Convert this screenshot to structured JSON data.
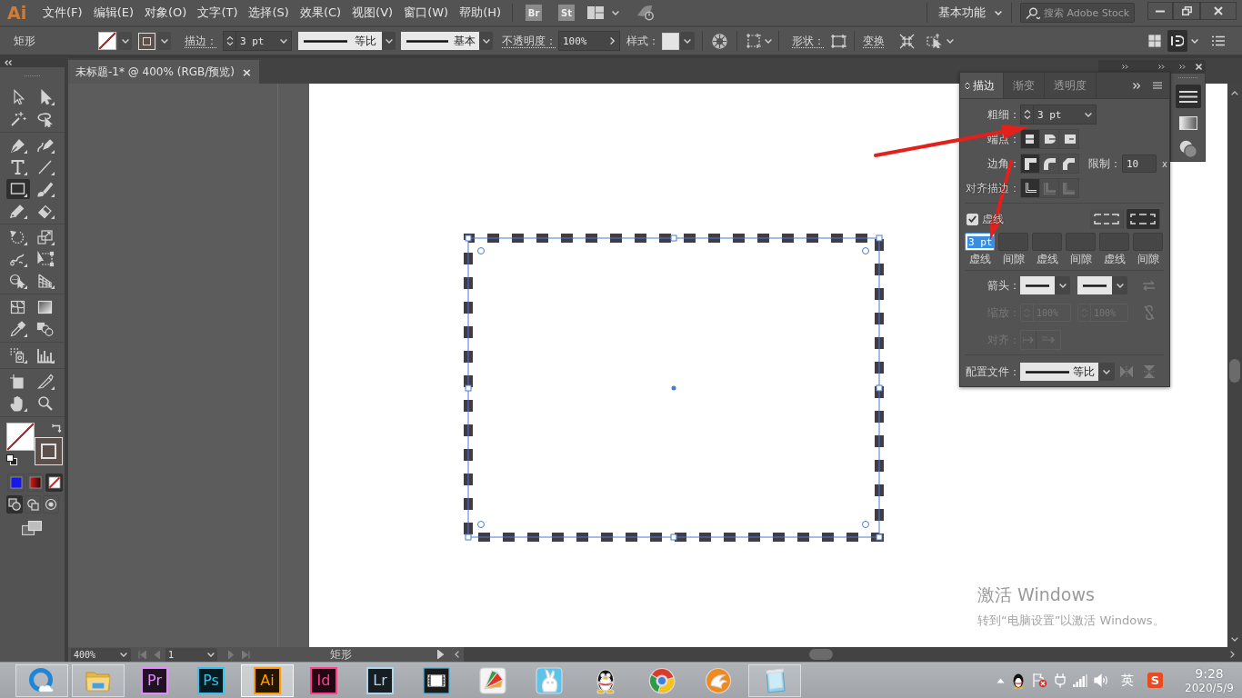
{
  "menu_bar": {
    "logo": "Ai",
    "menus": [
      "文件(F)",
      "编辑(E)",
      "对象(O)",
      "文字(T)",
      "选择(S)",
      "效果(C)",
      "视图(V)",
      "窗口(W)",
      "帮助(H)"
    ],
    "bridge": "Br",
    "stock": "St",
    "workspace": "基本功能",
    "search": {
      "placeholder": "搜索 Adobe Stock"
    }
  },
  "control_bar": {
    "object_type": "矩形",
    "stroke_label": "描边：",
    "stroke_weight": "3 pt",
    "profile": "等比",
    "brush": "基本",
    "opacity_label": "不透明度：",
    "opacity": "100%",
    "style_label": "样式：",
    "shape_label": "形状：",
    "transform": "变换"
  },
  "document_tab": {
    "title": "未标题-1* @ 400% (RGB/预览)",
    "close": "×"
  },
  "tool_groups": [
    [
      {
        "kind": "selection",
        "selected": false
      },
      {
        "kind": "direct_selection",
        "selected": false
      },
      {
        "kind": "magic_wand",
        "selected": false
      },
      {
        "kind": "lasso",
        "selected": false
      }
    ],
    [
      {
        "kind": "pen",
        "selected": false
      },
      {
        "kind": "curvature",
        "selected": false
      },
      {
        "kind": "type",
        "selected": false
      },
      {
        "kind": "line",
        "selected": false
      },
      {
        "kind": "rectangle",
        "selected": true
      },
      {
        "kind": "paintbrush",
        "selected": false
      },
      {
        "kind": "pencil",
        "selected": false
      },
      {
        "kind": "eraser",
        "selected": false
      }
    ],
    [
      {
        "kind": "rotate",
        "selected": false
      },
      {
        "kind": "scale",
        "selected": false
      },
      {
        "kind": "warp",
        "selected": false
      },
      {
        "kind": "free_transform",
        "selected": false
      },
      {
        "kind": "shape_builder",
        "selected": false
      },
      {
        "kind": "perspective_grid",
        "selected": false
      }
    ],
    [
      {
        "kind": "mesh",
        "selected": false
      },
      {
        "kind": "gradient",
        "selected": false
      },
      {
        "kind": "eyedropper",
        "selected": false
      },
      {
        "kind": "blend",
        "selected": false
      }
    ],
    [
      {
        "kind": "symbol_sprayer",
        "selected": false
      },
      {
        "kind": "column_graph",
        "selected": false
      }
    ],
    [
      {
        "kind": "artboard",
        "selected": false
      },
      {
        "kind": "slice",
        "selected": false
      },
      {
        "kind": "hand",
        "selected": false
      },
      {
        "kind": "zoom",
        "selected": false
      }
    ]
  ],
  "color_modes": [
    {
      "kind": "color",
      "selected": false
    },
    {
      "kind": "gradient",
      "selected": false
    },
    {
      "kind": "none",
      "selected": true
    }
  ],
  "draw_modes": [
    {
      "kind": "normal",
      "selected": true
    },
    {
      "kind": "behind",
      "selected": false
    },
    {
      "kind": "inside",
      "selected": false
    }
  ],
  "canvas": {
    "rectangle": {
      "selected": true
    }
  },
  "windows_notice": {
    "title": "激活 Windows",
    "detail": "转到“电脑设置”以激活 Windows。"
  },
  "dock": [
    {
      "kind": "stroke",
      "selected": true
    },
    {
      "kind": "gradient",
      "selected": false
    },
    {
      "kind": "transparency",
      "selected": false
    }
  ],
  "stroke_panel": {
    "tabs": [
      {
        "label": "描边",
        "selected": true
      },
      {
        "label": "渐变",
        "selected": false
      },
      {
        "label": "透明度",
        "selected": false
      }
    ],
    "weight_label": "粗细：",
    "weight": "3 pt",
    "cap_label": "端点：",
    "caps": [
      {
        "kind": "butt",
        "selected": true
      },
      {
        "kind": "round",
        "selected": false
      },
      {
        "kind": "projecting",
        "selected": false
      }
    ],
    "corner_label": "边角：",
    "corners": [
      {
        "kind": "miter",
        "selected": true
      },
      {
        "kind": "round",
        "selected": false
      },
      {
        "kind": "bevel",
        "selected": false
      }
    ],
    "limit_label": "限制：",
    "limit": "10",
    "limit_unit": "x",
    "align_label": "对齐描边：",
    "aligns": [
      {
        "kind": "center",
        "selected": true,
        "disabled": false
      },
      {
        "kind": "inside",
        "selected": false,
        "disabled": true
      },
      {
        "kind": "outside",
        "selected": false,
        "disabled": true
      }
    ],
    "dashed": {
      "label": "虚线",
      "checked": true
    },
    "dash_alignment": [
      {
        "kind": "preserve",
        "selected": false
      },
      {
        "kind": "corners",
        "selected": true
      }
    ],
    "dash_fields": [
      {
        "label": "虚线",
        "value": "3 pt",
        "selected": true
      },
      {
        "label": "间隙",
        "selected": false
      },
      {
        "label": "虚线",
        "selected": false
      },
      {
        "label": "间隙",
        "selected": false
      },
      {
        "label": "虚线",
        "selected": false
      },
      {
        "label": "间隙",
        "selected": false
      }
    ],
    "arrowheads_label": "箭头：",
    "scale_label": "缩放：",
    "scale": [
      "100%",
      "100%"
    ],
    "arrow_align_label": "对齐：",
    "arrow_options_disabled": true,
    "profile_label": "配置文件：",
    "profile": "等比"
  },
  "status_bar": {
    "zoom": "400%",
    "artboard": "1",
    "current_tool": "矩形"
  },
  "taskbar": {
    "apps": [
      {
        "kind": "ring_cloud",
        "running": true,
        "active": false
      },
      {
        "kind": "folder",
        "running": true,
        "active": false
      },
      {
        "kind": "tile",
        "label": "Pr",
        "color": "#e38afc",
        "running": false,
        "active": false
      },
      {
        "kind": "tile",
        "label": "Ps",
        "color": "#31c5f0",
        "running": false,
        "active": false
      },
      {
        "kind": "tile",
        "label": "Ai",
        "color": "#ff9a00",
        "running": true,
        "active": true
      },
      {
        "kind": "tile",
        "label": "Id",
        "color": "#ff3f8e",
        "running": false,
        "active": false
      },
      {
        "kind": "tile",
        "label": "Lr",
        "color": "#add5ec",
        "running": false,
        "active": false
      },
      {
        "kind": "film",
        "running": false,
        "active": false
      },
      {
        "kind": "fan",
        "running": false,
        "active": false
      },
      {
        "kind": "rabbit",
        "running": false,
        "active": false
      },
      {
        "kind": "penguin",
        "running": false,
        "active": false
      },
      {
        "kind": "browser",
        "running": false,
        "active": false
      },
      {
        "kind": "swirl",
        "running": false,
        "active": false
      },
      {
        "kind": "notepad",
        "running": true,
        "active": false
      }
    ],
    "tray": {
      "ime": "英",
      "ime_logo": "S",
      "time": "9:28",
      "date": "2020/5/9"
    }
  }
}
